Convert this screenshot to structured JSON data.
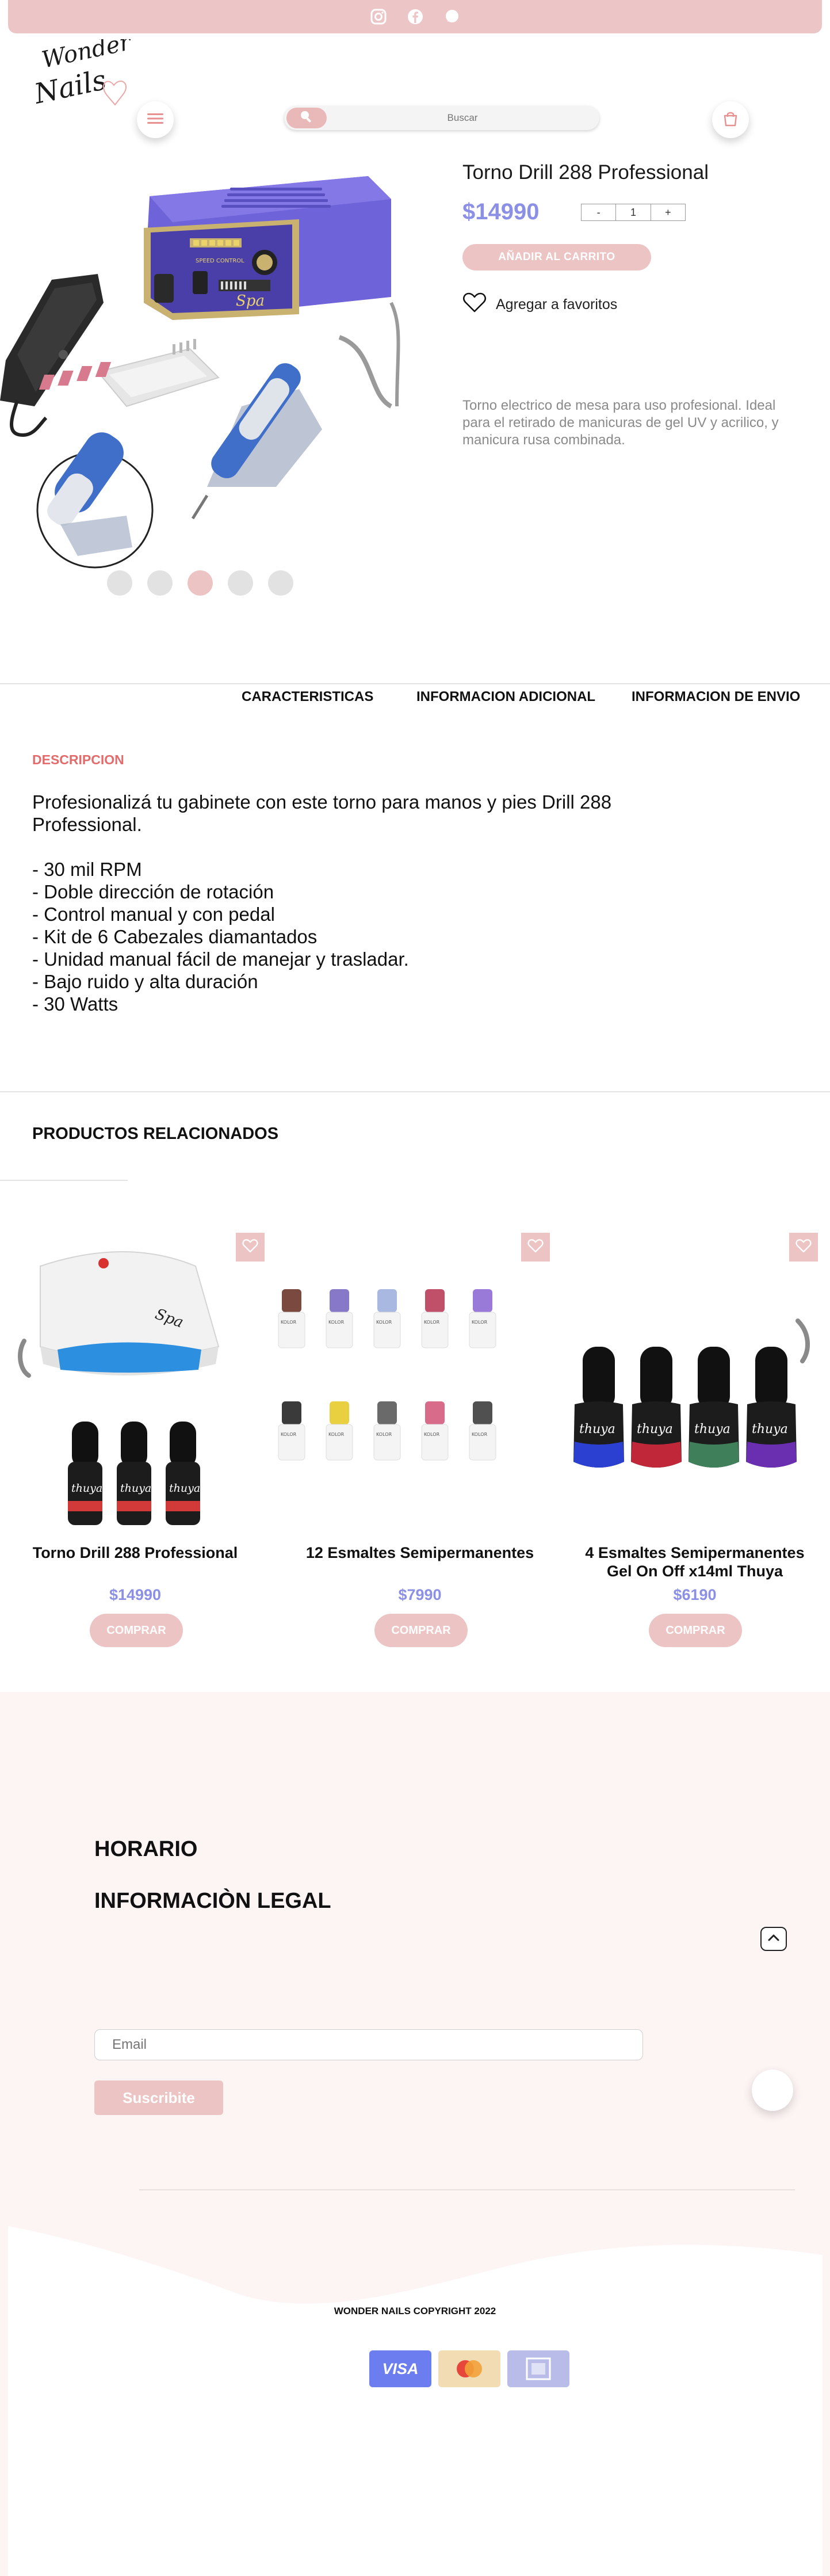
{
  "topbar": {
    "icons": [
      "instagram-icon",
      "facebook-icon",
      "whatsapp-icon"
    ],
    "color": "#ecc6c6"
  },
  "brand": {
    "logo_line1": "Wonder",
    "logo_line2": "Nails"
  },
  "search": {
    "placeholder": "Buscar"
  },
  "product": {
    "title": "Torno Drill 288 Professional",
    "price": "$14990",
    "qty_minus": "-",
    "qty_value": "1",
    "qty_plus": "+",
    "add_to_cart": "AÑADIR AL CARRITO",
    "favorite": "Agregar a favoritos",
    "short_description": "Torno electrico de mesa para uso profesional. Ideal para el retirado de manicuras de gel UV y acrilico, y manicura rusa combinada.",
    "image_slides": 5,
    "active_slide": 3,
    "device_labels": {
      "speed_control": "SPEED CONTROL",
      "brand": "Spa"
    }
  },
  "tabs": [
    {
      "label": "CARACTERISTICAS"
    },
    {
      "label": "INFORMACION ADICIONAL"
    },
    {
      "label": "INFORMACION DE ENVIO"
    }
  ],
  "description": {
    "title": "DESCRIPCION",
    "body": "Profesionalizá tu gabinete con este torno para manos y pies Drill 288\nProfessional.\n\n- 30 mil RPM\n- Doble dirección de rotación\n- Control manual y con pedal\n- Kit de 6 Cabezales diamantados\n- Unidad manual fácil de manejar y trasladar.\n- Bajo ruido y alta duración\n- 30 Watts"
  },
  "related": {
    "title": "PRODUCTOS RELACIONADOS",
    "items": [
      {
        "name": "Torno Drill 288 Professional",
        "price": "$14990",
        "button": "COMPRAR",
        "lamp_brand": "Spa",
        "bottle_brand": "thuya"
      },
      {
        "name": "12 Esmaltes Semipermanentes",
        "price": "$7990",
        "button": "COMPRAR",
        "bottle_brand": "KOLOR"
      },
      {
        "name": "4 Esmaltes Semipermanentes Gel On Off x14ml Thuya",
        "price": "$6190",
        "button": "COMPRAR",
        "bottle_brand": "thuya"
      }
    ]
  },
  "footer": {
    "horario": "HORARIO",
    "legal": "INFORMACIÒN LEGAL",
    "email_placeholder": "Email",
    "subscribe": "Suscribite",
    "copyright": "WONDER NAILS  COPYRIGHT 2022",
    "payments": [
      {
        "name": "visa-icon",
        "label": "VISA",
        "color": "#6c7df0"
      },
      {
        "name": "mastercard-icon",
        "label": "",
        "color": "#f1dcb4"
      },
      {
        "name": "amex-icon",
        "label": "AMERICAN EXPRESS",
        "color": "#b9bce8"
      }
    ]
  },
  "colors": {
    "accent_pink": "#edc4c4",
    "price_purple": "#8b90e6",
    "desc_title_red": "#e36b6b"
  }
}
